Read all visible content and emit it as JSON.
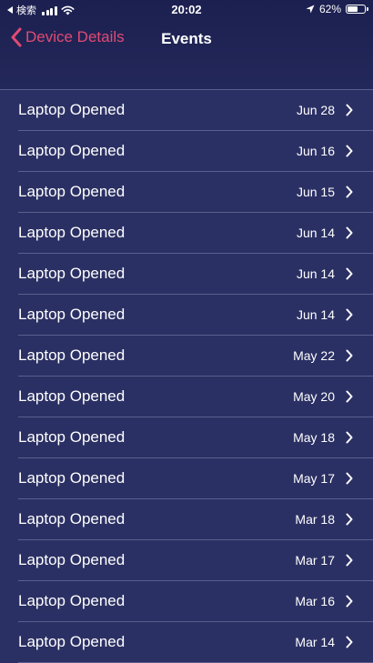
{
  "status_bar": {
    "carrier": "検索",
    "time": "20:02",
    "battery": "62%",
    "battery_level": 0.62
  },
  "nav": {
    "back_label": "Device Details",
    "title": "Events"
  },
  "events": [
    {
      "title": "Laptop Opened",
      "date": "Jun 28"
    },
    {
      "title": "Laptop Opened",
      "date": "Jun 16"
    },
    {
      "title": "Laptop Opened",
      "date": "Jun 15"
    },
    {
      "title": "Laptop Opened",
      "date": "Jun 14"
    },
    {
      "title": "Laptop Opened",
      "date": "Jun 14"
    },
    {
      "title": "Laptop Opened",
      "date": "Jun 14"
    },
    {
      "title": "Laptop Opened",
      "date": "May 22"
    },
    {
      "title": "Laptop Opened",
      "date": "May 20"
    },
    {
      "title": "Laptop Opened",
      "date": "May 18"
    },
    {
      "title": "Laptop Opened",
      "date": "May 17"
    },
    {
      "title": "Laptop Opened",
      "date": "Mar 18"
    },
    {
      "title": "Laptop Opened",
      "date": "Mar 17"
    },
    {
      "title": "Laptop Opened",
      "date": "Mar 16"
    },
    {
      "title": "Laptop Opened",
      "date": "Mar 14"
    }
  ],
  "icons": {
    "back": "chevron-left-icon",
    "disclosure": "chevron-right-icon",
    "wifi": "wifi-icon",
    "location": "location-arrow-icon",
    "battery": "battery-icon",
    "signal": "signal-bars-icon"
  },
  "colors": {
    "background": "#2b3064",
    "nav_background": "#1c2050",
    "accent": "#e24a73",
    "separator": "#5a5f8e",
    "text": "#ffffff"
  }
}
